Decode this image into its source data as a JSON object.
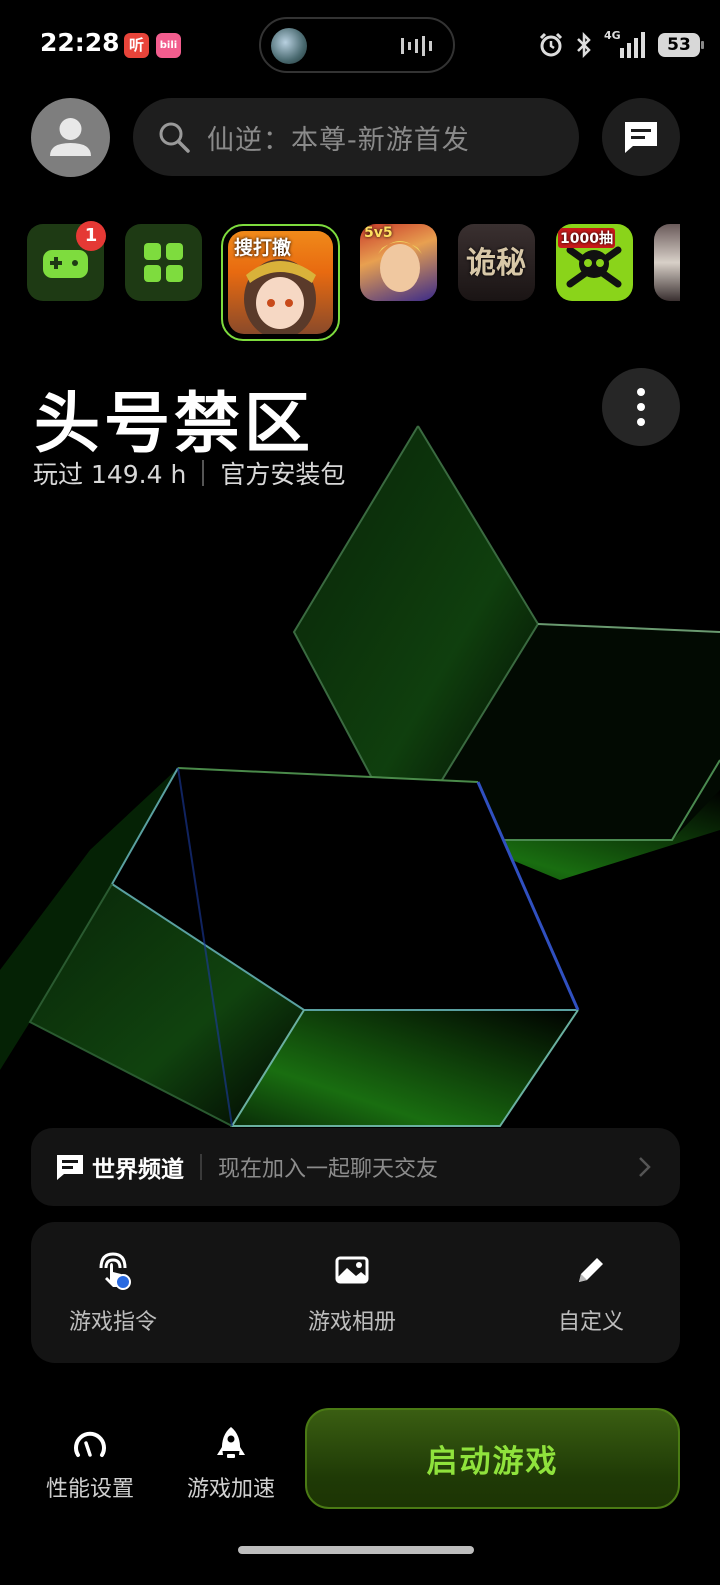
{
  "status_bar": {
    "time": "22:28",
    "app_badge_1": "听",
    "app_badge_2": "bili",
    "network": "4G",
    "battery": "53"
  },
  "header": {
    "search_placeholder": "仙逆：本尊-新游首发"
  },
  "game_row": {
    "notification_count": "1",
    "games": [
      {
        "label": "搜打撤"
      },
      {
        "label": "5v5"
      },
      {
        "label": "诡秘"
      },
      {
        "label": "1000抽"
      }
    ]
  },
  "game": {
    "title": "头号禁区",
    "playtime": "玩过 149.4 h",
    "source": "官方安装包"
  },
  "world_channel": {
    "title": "世界频道",
    "desc": "现在加入一起聊天交友"
  },
  "tools": [
    {
      "label": "游戏指令",
      "icon": "touch-ai-icon"
    },
    {
      "label": "游戏相册",
      "icon": "album-icon"
    },
    {
      "label": "自定义",
      "icon": "pencil-icon"
    }
  ],
  "bottom_bar": {
    "performance": "性能设置",
    "accelerate": "游戏加速",
    "launch": "启动游戏"
  },
  "colors": {
    "accent_green": "#8fe23c",
    "badge_red": "#e53935",
    "card_bg": "#141414"
  }
}
